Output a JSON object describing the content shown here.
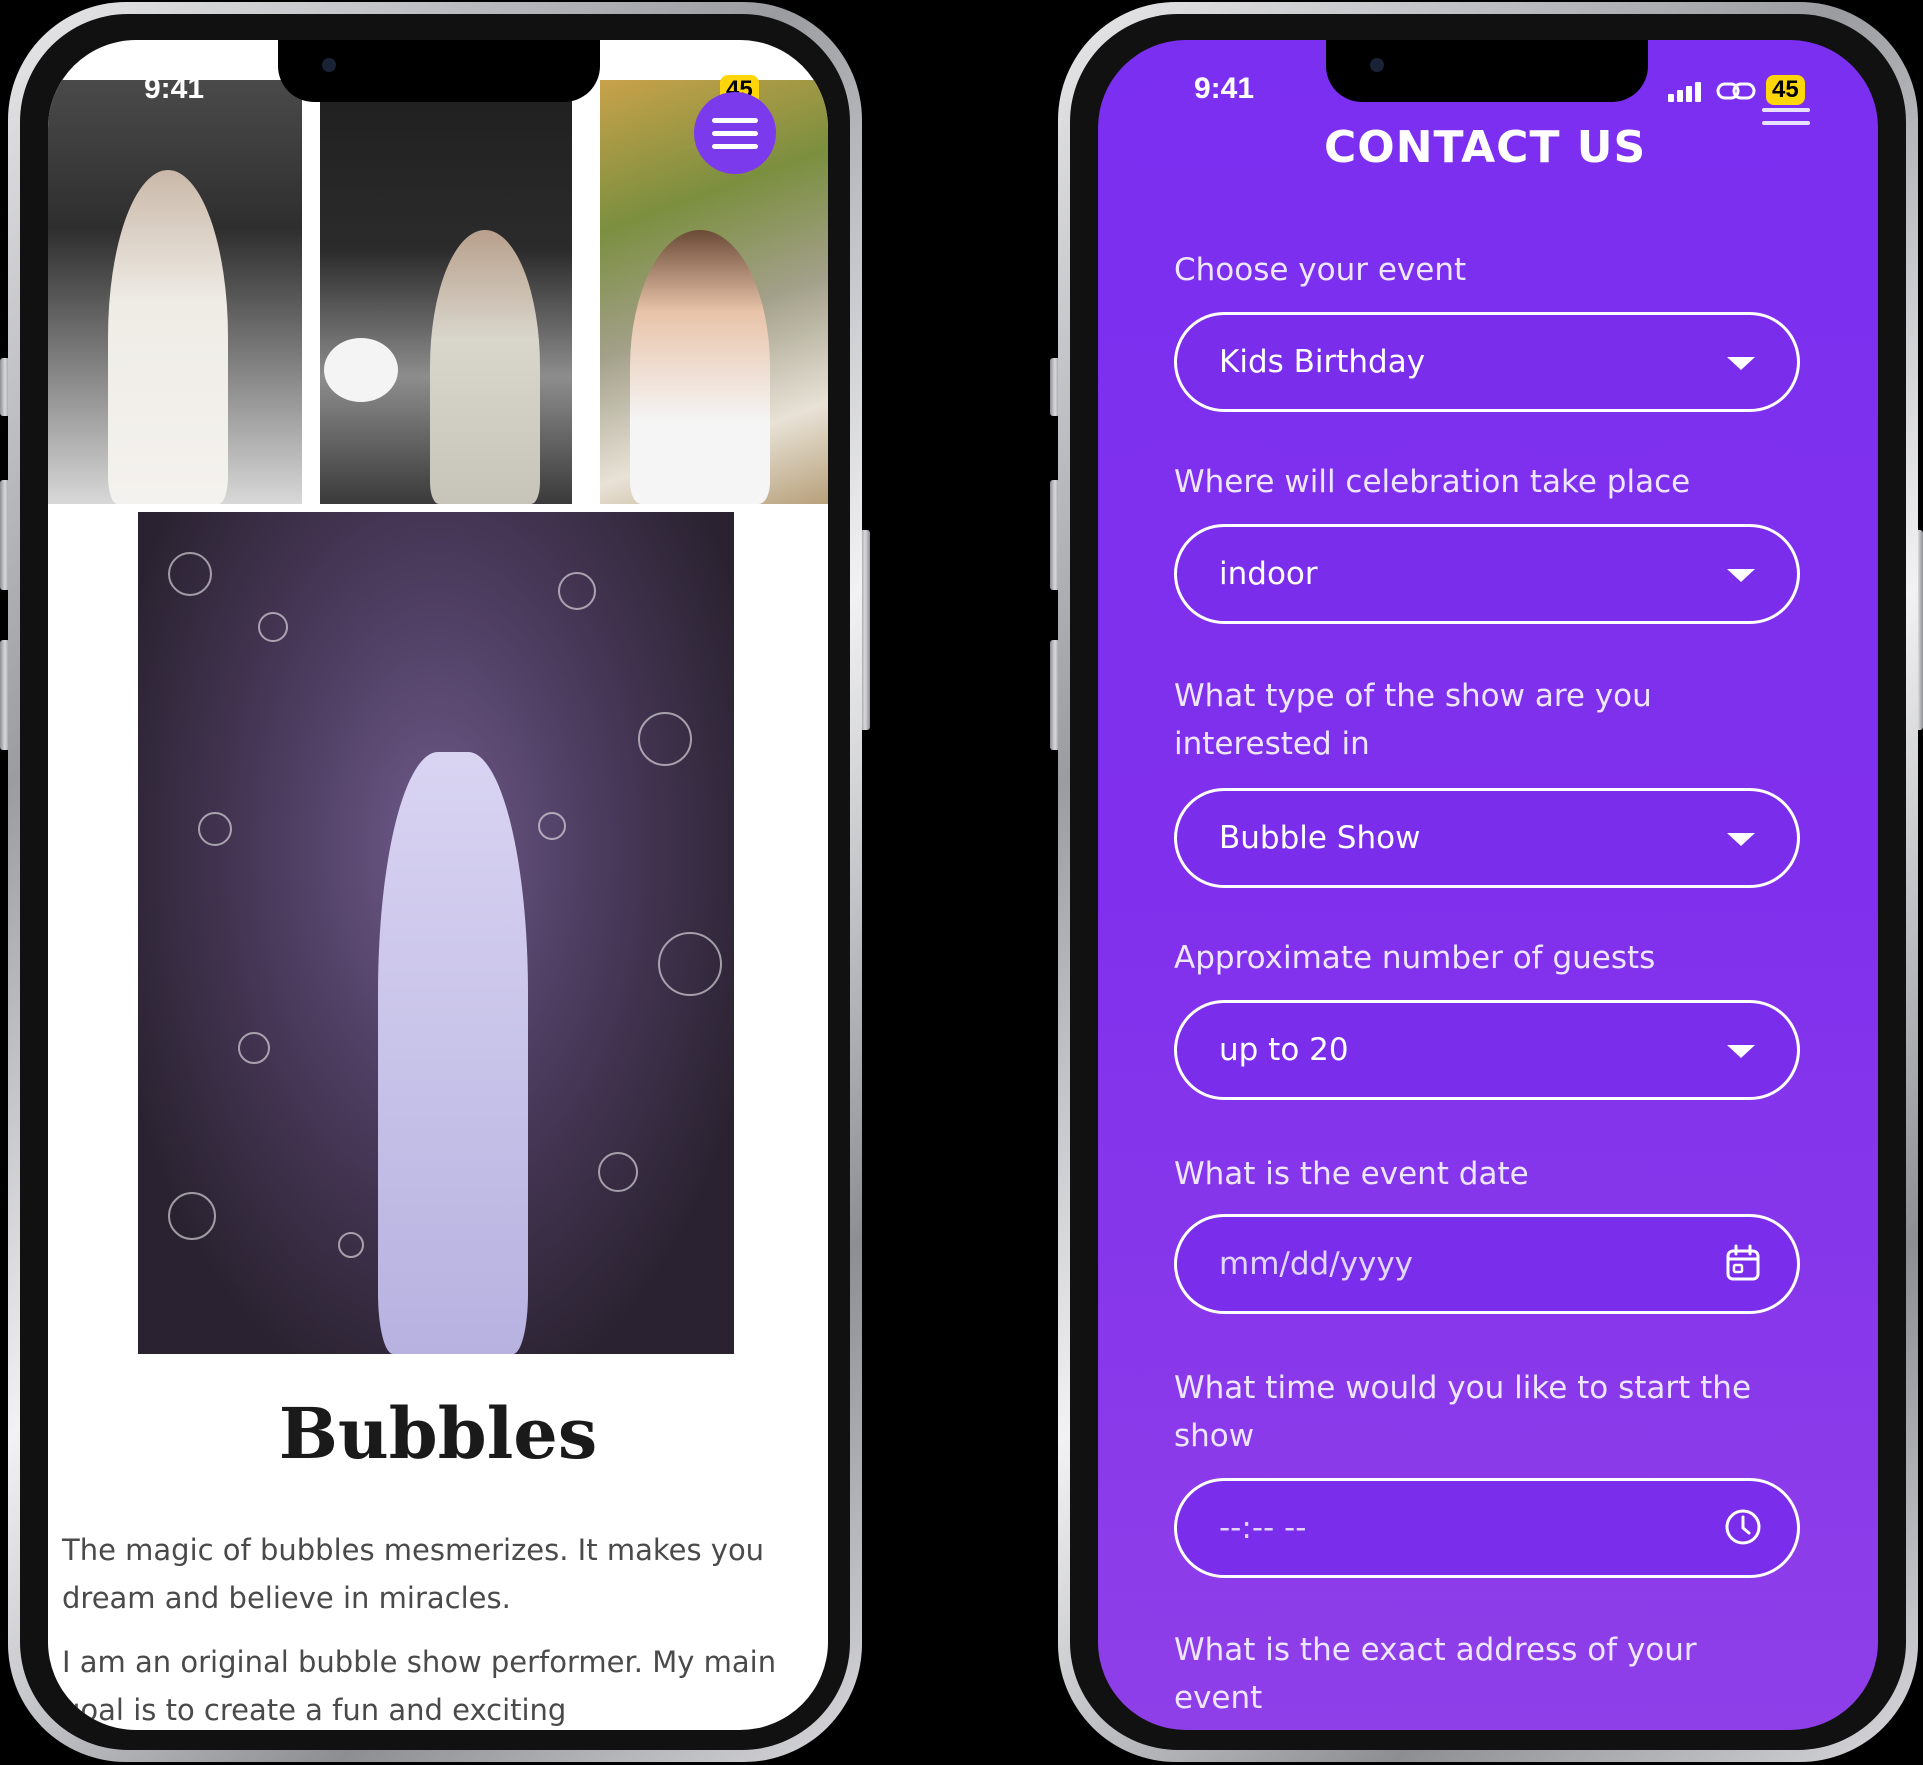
{
  "left_phone": {
    "status": {
      "time": "9:41",
      "battery": "45"
    },
    "article": {
      "title": "Bubbles",
      "paragraph_1": "The magic of bubbles mesmerizes. It makes you dream and believe in miracles.",
      "paragraph_2": "I am an original bubble show performer. My main goal is to create a fun and exciting"
    }
  },
  "right_phone": {
    "status": {
      "time": "9:41",
      "battery": "45"
    },
    "title": "CONTACT US",
    "form": {
      "event": {
        "label": "Choose your event",
        "value": "Kids Birthday"
      },
      "place": {
        "label": "Where will celebration take place",
        "value": "indoor"
      },
      "show": {
        "label": "What type of the show are you interested in",
        "value": "Bubble Show"
      },
      "guests": {
        "label": "Approximate number of guests",
        "value": "up to 20"
      },
      "date": {
        "label": "What is the event date",
        "placeholder": "mm/dd/yyyy"
      },
      "time": {
        "label": "What time would you like to start the show",
        "placeholder": "--:-- --"
      },
      "address": {
        "label": "What is the exact address of your event"
      }
    }
  },
  "colors": {
    "accent": "#7c3aed",
    "form_bg": "#8030ec"
  },
  "icons": [
    "menu-icon",
    "chevron-down-icon",
    "calendar-icon",
    "clock-icon",
    "signal-icon",
    "link-icon"
  ]
}
